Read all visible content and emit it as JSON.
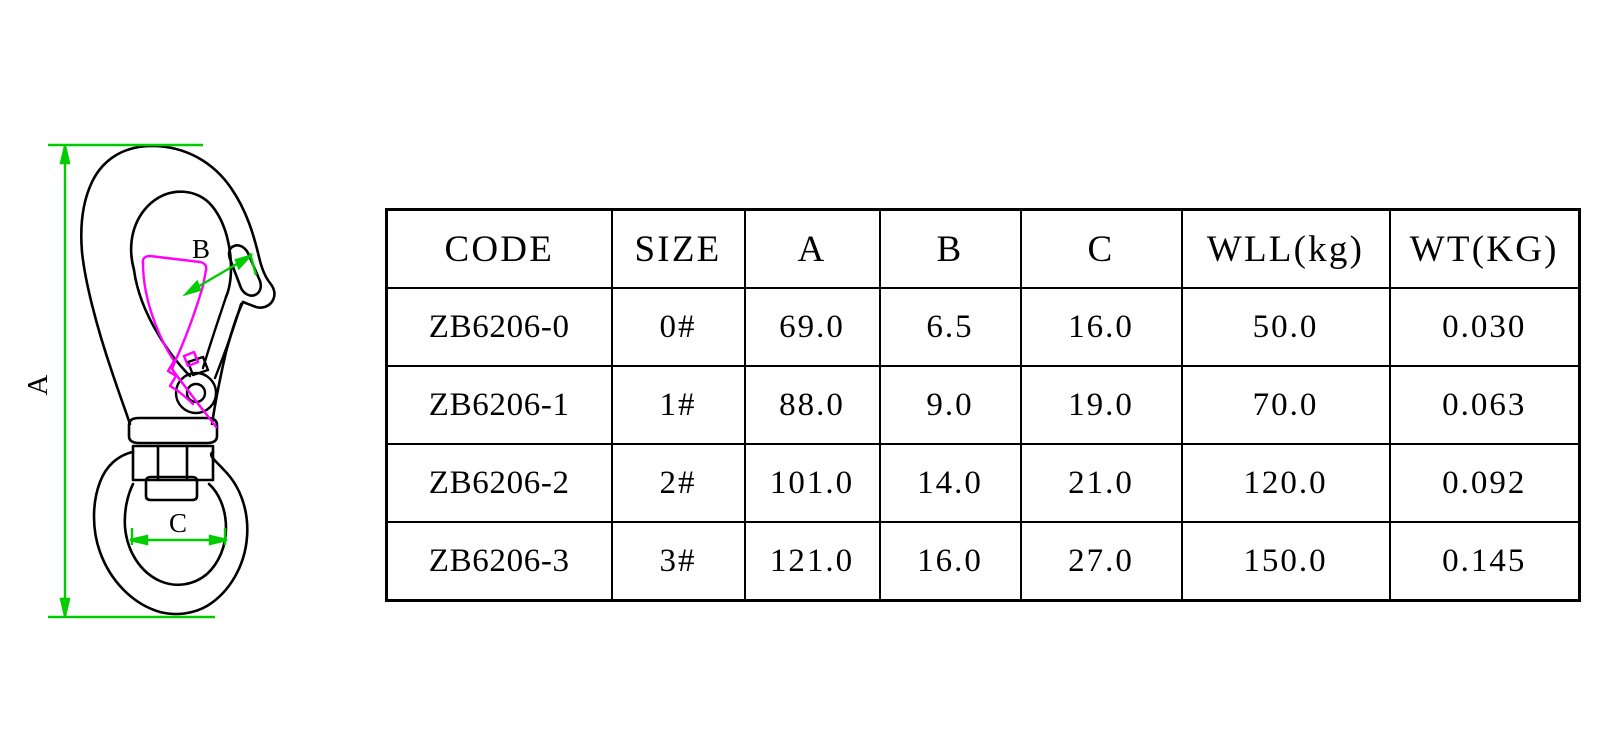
{
  "drawing": {
    "title": "swivel-eye-snap-hook-technical-drawing",
    "labels": {
      "a": "A",
      "b": "B",
      "c": "C"
    },
    "colors": {
      "outline": "#000000",
      "gate": "#FF00FF",
      "dimension": "#00CC00",
      "background": "#FFFFFF"
    }
  },
  "table": {
    "headers": [
      "CODE",
      "SIZE",
      "A",
      "B",
      "C",
      "WLL(kg)",
      "WT(KG)"
    ],
    "rows": [
      {
        "code": "ZB6206-0",
        "size": "0#",
        "a": "69.0",
        "b": "6.5",
        "c": "16.0",
        "wll": "50.0",
        "wt": "0.030"
      },
      {
        "code": "ZB6206-1",
        "size": "1#",
        "a": "88.0",
        "b": "9.0",
        "c": "19.0",
        "wll": "70.0",
        "wt": "0.063"
      },
      {
        "code": "ZB6206-2",
        "size": "2#",
        "a": "101.0",
        "b": "14.0",
        "c": "21.0",
        "wll": "120.0",
        "wt": "0.092"
      },
      {
        "code": "ZB6206-3",
        "size": "3#",
        "a": "121.0",
        "b": "16.0",
        "c": "27.0",
        "wll": "150.0",
        "wt": "0.145"
      }
    ]
  }
}
